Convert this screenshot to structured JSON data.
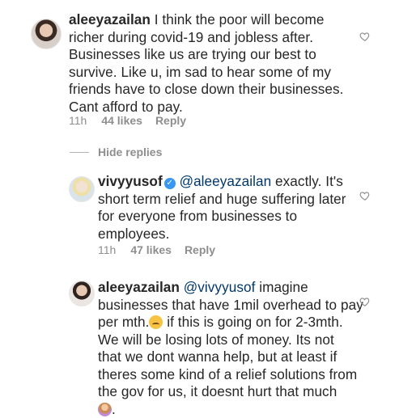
{
  "comments": [
    {
      "username": "aleeyazailan",
      "lines": [
        " I think the poor will become",
        "richer during covid-19 and jobless after.",
        "Businesses like us are trying our best to",
        "survive. Like u, im sad to hear some of my",
        "friends have to close down their businesses.",
        "Cant afford to pay."
      ],
      "time": "11h",
      "likes": "44 likes",
      "reply": "Reply"
    }
  ],
  "hide_replies": "Hide replies",
  "replies": [
    {
      "username": "vivyyusof",
      "verified_icon": "✓",
      "mention": "@aleeyazailan",
      "first_line_rest": " exactly. It's",
      "lines": [
        "short term relief and huge suffering later",
        "for everyone from businesses to",
        "employees."
      ],
      "time": "11h",
      "likes": "47 likes",
      "reply": "Reply"
    },
    {
      "username": "aleeyazailan",
      "mention": "@vivyyusof",
      "first_line_rest": " imagine",
      "line2": "businesses that have 1mil overhead to pay",
      "line3_a": "per mth.",
      "line3_b": " if this is going on for 2-3mth.",
      "lines": [
        "We will be losing lots of money. Its not",
        "that we dont wanna help, but at least if",
        "theres some kind of a relief solutions from",
        "the gov for us, it doesnt hurt that much"
      ],
      "line_end": "."
    }
  ],
  "icons": {
    "heart": "heart-icon",
    "verified": "verified-badge-icon",
    "emoji_1": "worried-face-emoji-icon",
    "emoji_2": "person-emoji-icon"
  },
  "colors": {
    "text": "#262626",
    "meta": "#8e8e8e",
    "verified": "#3897f0"
  }
}
